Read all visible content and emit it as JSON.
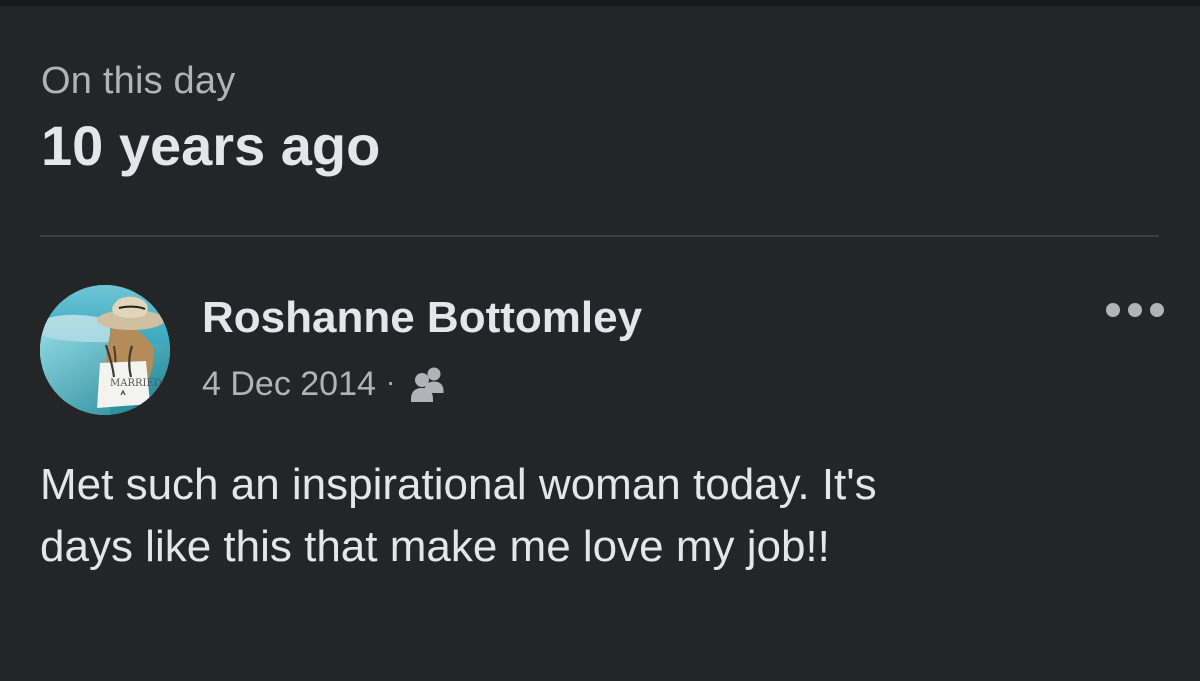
{
  "memory": {
    "kicker": "On this day",
    "heading": "10 years ago"
  },
  "post": {
    "author": "Roshanne Bottomley",
    "date": "4 Dec 2014",
    "separator": "·",
    "audience_icon": "friends-audience-icon",
    "more_icon": "more-options-icon",
    "text": "Met such an inspirational woman today. It's\ndays like this that make me love my job!!",
    "avatar_bag_text": "MARRIED"
  },
  "colors": {
    "background": "#242526",
    "primary_text": "#e4e6eb",
    "secondary_text": "#b0b3b8",
    "divider": "#3e4042"
  }
}
